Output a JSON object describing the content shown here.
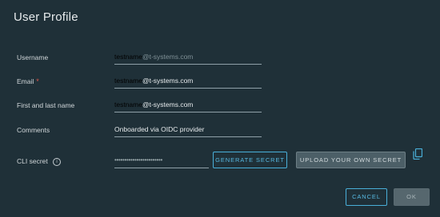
{
  "dialog": {
    "title": "User Profile"
  },
  "form": {
    "username": {
      "label": "Username",
      "user": "testname",
      "domain": "@t-systems.com"
    },
    "email": {
      "label": "Email",
      "required_mark": "*",
      "user": "testname",
      "domain": "@t-systems.com"
    },
    "full_name": {
      "label": "First and last name",
      "user": "testname",
      "domain": "@t-systems.com"
    },
    "comments": {
      "label": "Comments",
      "value": "Onboarded via OIDC provider"
    },
    "cli_secret": {
      "label": "CLI secret",
      "info_glyph": "i",
      "masked_value": "••••••••••••••••••••••••",
      "generate_label": "GENERATE SECRET",
      "upload_label": "UPLOAD YOUR OWN SECRET",
      "copy_icon": "copy-icon",
      "info_icon": "info-icon"
    }
  },
  "footer": {
    "cancel_label": "CANCEL",
    "ok_label": "OK"
  },
  "colors": {
    "background": "#1f3038",
    "accent": "#49afd9",
    "required": "#e2574c"
  }
}
